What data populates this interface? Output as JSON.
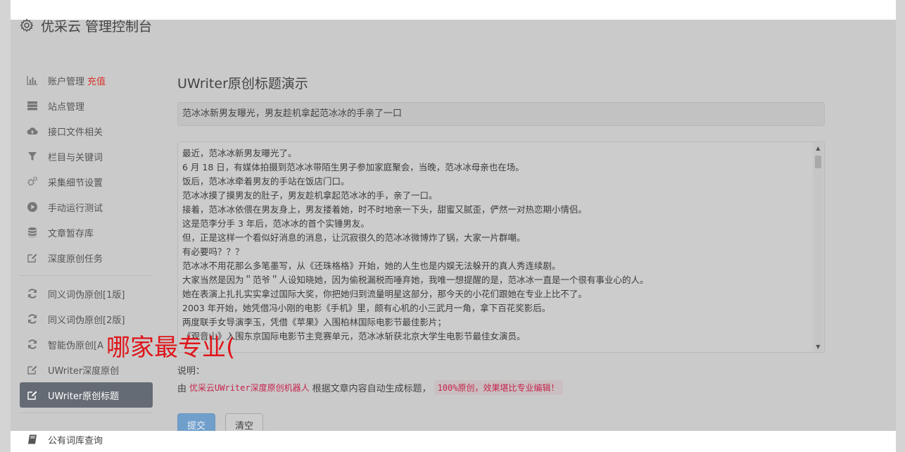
{
  "header": {
    "title": "优采云 管理控制台",
    "icon": "gear-icon"
  },
  "sidebar": {
    "items": [
      {
        "label": "账户管理",
        "extra": "充值",
        "icon": "bar-chart-icon"
      },
      {
        "label": "站点管理",
        "icon": "server-icon"
      },
      {
        "label": "接口文件相关",
        "icon": "cloud-upload-icon"
      },
      {
        "label": "栏目与关键词",
        "icon": "filter-icon"
      },
      {
        "label": "采集细节设置",
        "icon": "cogs-icon"
      },
      {
        "label": "手动运行测试",
        "icon": "play-circle-icon"
      },
      {
        "label": "文章暂存库",
        "icon": "database-icon"
      },
      {
        "label": "深度原创任务",
        "icon": "edit-icon"
      },
      {
        "label": "同义词伪原创[1版]",
        "icon": "refresh-icon"
      },
      {
        "label": "同义词伪原创[2版]",
        "icon": "refresh-icon"
      },
      {
        "label": "智能伪原创[A",
        "icon": "refresh-icon"
      },
      {
        "label": "UWriter深度原创",
        "icon": "edit-icon"
      },
      {
        "label": "UWriter原创标题",
        "icon": "edit-icon",
        "active": true
      }
    ],
    "bottom_item": {
      "label": "公有词库查询",
      "icon": "book-icon"
    }
  },
  "main": {
    "title": "UWriter原创标题演示",
    "title_value": "范冰冰新男友曝光，男友趁机拿起范冰冰的手亲了一口",
    "content_lines": [
      "最近，范冰冰新男友曝光了。",
      "6 月 18 日，有媒体拍摄到范冰冰带陌生男子参加家庭聚会，当晚，范冰冰母亲也在场。",
      "饭后，范冰冰牵着男友的手站在饭店门口。",
      "范冰冰摸了摸男友的肚子，男友趁机拿起范冰冰的手，亲了一口。",
      "接着，范冰冰依偎在男友身上，男友搂着她，时不时地亲一下头，甜蜜又腻歪，俨然一对热恋期小情侣。",
      "这是范李分手 3 年后，范冰冰的首个实锤男友。",
      "但，正是这样一个看似好消息的消息，让沉寂很久的范冰冰微博炸了锅，大家一片群嘲。",
      "有必要吗？？？",
      "范冰冰不用花那么多笔墨写，从《还珠格格》开始，她的人生也是内娱无法躲开的真人秀连续剧。",
      "大家当然是因为＂范爷＂人设知晓她，因为偷税漏税而唾弃她，我唯一想提醒的是，范冰冰一直是一个很有事业心的人。",
      "她在表演上扎扎实实拿过国际大奖，你把她归到流量明星这部分，那今天的小花们跟她在专业上比不了。",
      "2003 年开始，她凭借冯小刚的电影《手机》里，颇有心机的小三武月一角，拿下百花奖影后。",
      "两度联手女导演李玉，凭借《苹果》入围柏林国际电影节最佳影片；",
      "《观音山》入围东京国际电影节主竞赛单元，范冰冰斩获北京大学生电影节最佳女演员。"
    ],
    "explain_label": "说明：",
    "explain_prefix": "由",
    "explain_code1": "优采云UWriter深度原创机器人",
    "explain_mid": "根据文章内容自动生成标题，",
    "explain_code2": "100%原创，效果堪比专业编辑！",
    "submit_label": "提交",
    "clear_label": "清空"
  },
  "overlay": {
    "text": "哪家最专业("
  },
  "colors": {
    "accent_red": "#d9342b",
    "active_bg": "#656b74",
    "submit_bg": "#6f9fca",
    "overlay_red": "#e0151a"
  }
}
